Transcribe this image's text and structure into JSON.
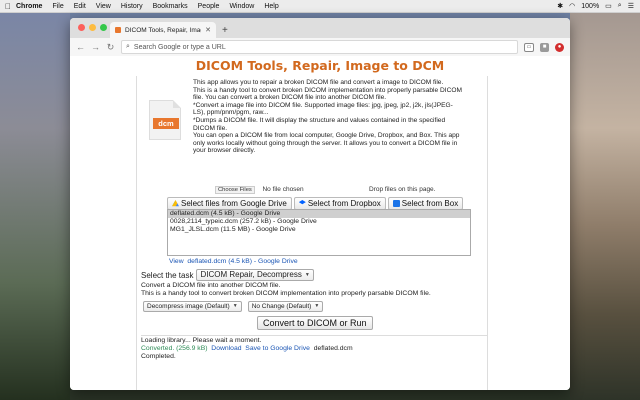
{
  "menubar": {
    "app": "Chrome",
    "items": [
      "File",
      "Edit",
      "View",
      "History",
      "Bookmarks",
      "People",
      "Window",
      "Help"
    ],
    "battery": "100%"
  },
  "browser": {
    "tab_title": "DICOM Tools, Repair, Image to",
    "omnibox_placeholder": "Search Google or type a URL"
  },
  "page": {
    "title": "DICOM Tools, Repair, Image to DCM",
    "logo_label": "dcm",
    "description": [
      "This app allows you to repair a broken DICOM file and convert a image to DICOM file.",
      "This is a handy tool to convert broken DICOM implementation into properly parsable DICOM",
      "file. You can convert a broken DICOM file into another DICOM file.",
      "*Convert a image file into DICOM file. Supported image files: jpg, jpeg, jp2, j2k, jls(JPEG-",
      "LS), ppm/pnm/pgm, raw...",
      "*Dumps a DICOM file. It will display the structure and values contained in the specified",
      "DICOM file.",
      "You can open a DICOM file from local computer, Google Drive, Dropbox, and Box. This app",
      "only works locally without going through the server. It allows you to convert a DICOM file in",
      "your browser directly."
    ],
    "choose_files": "Choose Files",
    "no_file": "No file chosen",
    "drop_hint": "Drop files on this page.",
    "buttons": {
      "gdrive": "Select files from Google Drive",
      "dropbox": "Select from Dropbox",
      "box": "Select from Box"
    },
    "files": [
      "deflated.dcm (4.5 kB) - Google Drive",
      "0028,2114_typeic.dcm (257.2 kB) - Google Drive",
      "MG1_JLSL.dcm (11.5 MB) - Google Drive"
    ],
    "view_link": "View",
    "view_text": "deflated.dcm (4.5 kB) - Google Drive",
    "task_label": "Select the task",
    "task_value": "DICOM Repair, Decompress",
    "task_desc": [
      "Convert a DICOM file into another DICOM file.",
      "This is a handy tool to convert broken DICOM implementation into properly parsable DICOM file."
    ],
    "option1": "Decompress image (Default)",
    "option2": "No Change (Default)",
    "convert_button": "Convert to DICOM or Run",
    "output": {
      "loading": "Loading library... Please wait a moment.",
      "converted": "Converted. (256.9 kB)",
      "download": "Download",
      "save": "Save to Google Drive",
      "filename": "deflated.dcm",
      "completed": "Completed."
    }
  }
}
